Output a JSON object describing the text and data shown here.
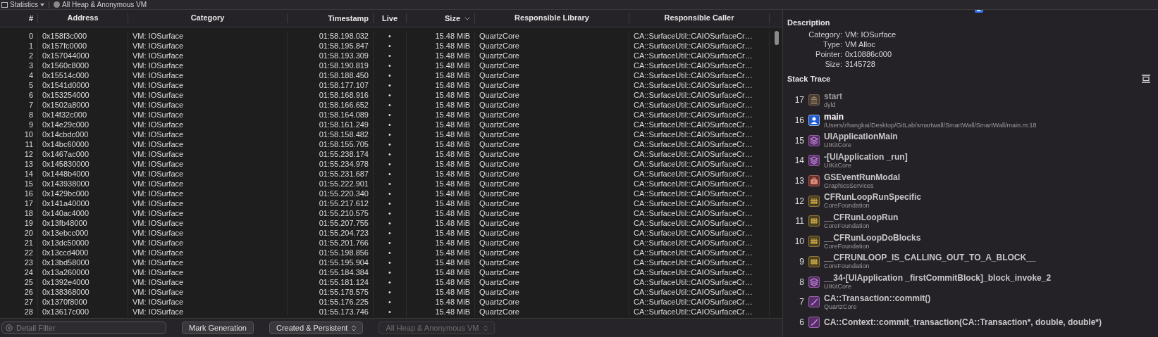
{
  "toolbar": {
    "view_menu": "Statistics",
    "scope": "All Heap & Anonymous VM"
  },
  "table": {
    "columns": [
      {
        "label": "#"
      },
      {
        "label": "Address"
      },
      {
        "label": "Category"
      },
      {
        "label": "Timestamp"
      },
      {
        "label": "Live"
      },
      {
        "label": "Size",
        "sorted": true
      },
      {
        "label": "Responsible Library"
      },
      {
        "label": "Responsible Caller"
      }
    ],
    "rows": [
      [
        "0",
        "0x158f3c000",
        "VM: IOSurface",
        "01:58.198.032",
        "•",
        "15.48 MiB",
        "QuartzCore",
        "CA::SurfaceUtil::CAIOSurfaceCr…"
      ],
      [
        "1",
        "0x157fc0000",
        "VM: IOSurface",
        "01:58.195.847",
        "•",
        "15.48 MiB",
        "QuartzCore",
        "CA::SurfaceUtil::CAIOSurfaceCr…"
      ],
      [
        "2",
        "0x157044000",
        "VM: IOSurface",
        "01:58.193.309",
        "•",
        "15.48 MiB",
        "QuartzCore",
        "CA::SurfaceUtil::CAIOSurfaceCr…"
      ],
      [
        "3",
        "0x1560c8000",
        "VM: IOSurface",
        "01:58.190.819",
        "•",
        "15.48 MiB",
        "QuartzCore",
        "CA::SurfaceUtil::CAIOSurfaceCr…"
      ],
      [
        "4",
        "0x15514c000",
        "VM: IOSurface",
        "01:58.188.450",
        "•",
        "15.48 MiB",
        "QuartzCore",
        "CA::SurfaceUtil::CAIOSurfaceCr…"
      ],
      [
        "5",
        "0x1541d0000",
        "VM: IOSurface",
        "01:58.177.107",
        "•",
        "15.48 MiB",
        "QuartzCore",
        "CA::SurfaceUtil::CAIOSurfaceCr…"
      ],
      [
        "6",
        "0x153254000",
        "VM: IOSurface",
        "01:58.168.916",
        "•",
        "15.48 MiB",
        "QuartzCore",
        "CA::SurfaceUtil::CAIOSurfaceCr…"
      ],
      [
        "7",
        "0x1502a8000",
        "VM: IOSurface",
        "01:58.166.652",
        "•",
        "15.48 MiB",
        "QuartzCore",
        "CA::SurfaceUtil::CAIOSurfaceCr…"
      ],
      [
        "8",
        "0x14f32c000",
        "VM: IOSurface",
        "01:58.164.089",
        "•",
        "15.48 MiB",
        "QuartzCore",
        "CA::SurfaceUtil::CAIOSurfaceCr…"
      ],
      [
        "9",
        "0x14e29c000",
        "VM: IOSurface",
        "01:58.161.249",
        "•",
        "15.48 MiB",
        "QuartzCore",
        "CA::SurfaceUtil::CAIOSurfaceCr…"
      ],
      [
        "10",
        "0x14cbdc000",
        "VM: IOSurface",
        "01:58.158.482",
        "•",
        "15.48 MiB",
        "QuartzCore",
        "CA::SurfaceUtil::CAIOSurfaceCr…"
      ],
      [
        "11",
        "0x14bc60000",
        "VM: IOSurface",
        "01:58.155.705",
        "•",
        "15.48 MiB",
        "QuartzCore",
        "CA::SurfaceUtil::CAIOSurfaceCr…"
      ],
      [
        "12",
        "0x1467ac000",
        "VM: IOSurface",
        "01:55.238.174",
        "•",
        "15.48 MiB",
        "QuartzCore",
        "CA::SurfaceUtil::CAIOSurfaceCr…"
      ],
      [
        "13",
        "0x145830000",
        "VM: IOSurface",
        "01:55.234.978",
        "•",
        "15.48 MiB",
        "QuartzCore",
        "CA::SurfaceUtil::CAIOSurfaceCr…"
      ],
      [
        "14",
        "0x1448b4000",
        "VM: IOSurface",
        "01:55.231.687",
        "•",
        "15.48 MiB",
        "QuartzCore",
        "CA::SurfaceUtil::CAIOSurfaceCr…"
      ],
      [
        "15",
        "0x143938000",
        "VM: IOSurface",
        "01:55.222.901",
        "•",
        "15.48 MiB",
        "QuartzCore",
        "CA::SurfaceUtil::CAIOSurfaceCr…"
      ],
      [
        "16",
        "0x1429bc000",
        "VM: IOSurface",
        "01:55.220.340",
        "•",
        "15.48 MiB",
        "QuartzCore",
        "CA::SurfaceUtil::CAIOSurfaceCr…"
      ],
      [
        "17",
        "0x141a40000",
        "VM: IOSurface",
        "01:55.217.612",
        "•",
        "15.48 MiB",
        "QuartzCore",
        "CA::SurfaceUtil::CAIOSurfaceCr…"
      ],
      [
        "18",
        "0x140ac4000",
        "VM: IOSurface",
        "01:55.210.575",
        "•",
        "15.48 MiB",
        "QuartzCore",
        "CA::SurfaceUtil::CAIOSurfaceCr…"
      ],
      [
        "19",
        "0x13fb48000",
        "VM: IOSurface",
        "01:55.207.755",
        "•",
        "15.48 MiB",
        "QuartzCore",
        "CA::SurfaceUtil::CAIOSurfaceCr…"
      ],
      [
        "20",
        "0x13ebcc000",
        "VM: IOSurface",
        "01:55.204.723",
        "•",
        "15.48 MiB",
        "QuartzCore",
        "CA::SurfaceUtil::CAIOSurfaceCr…"
      ],
      [
        "21",
        "0x13dc50000",
        "VM: IOSurface",
        "01:55.201.766",
        "•",
        "15.48 MiB",
        "QuartzCore",
        "CA::SurfaceUtil::CAIOSurfaceCr…"
      ],
      [
        "22",
        "0x13ccd4000",
        "VM: IOSurface",
        "01:55.198.856",
        "•",
        "15.48 MiB",
        "QuartzCore",
        "CA::SurfaceUtil::CAIOSurfaceCr…"
      ],
      [
        "23",
        "0x13bd58000",
        "VM: IOSurface",
        "01:55.195.904",
        "•",
        "15.48 MiB",
        "QuartzCore",
        "CA::SurfaceUtil::CAIOSurfaceCr…"
      ],
      [
        "24",
        "0x13a260000",
        "VM: IOSurface",
        "01:55.184.384",
        "•",
        "15.48 MiB",
        "QuartzCore",
        "CA::SurfaceUtil::CAIOSurfaceCr…"
      ],
      [
        "25",
        "0x1392e4000",
        "VM: IOSurface",
        "01:55.181.124",
        "•",
        "15.48 MiB",
        "QuartzCore",
        "CA::SurfaceUtil::CAIOSurfaceCr…"
      ],
      [
        "26",
        "0x138368000",
        "VM: IOSurface",
        "01:55.178.575",
        "•",
        "15.48 MiB",
        "QuartzCore",
        "CA::SurfaceUtil::CAIOSurfaceCr…"
      ],
      [
        "27",
        "0x1370f8000",
        "VM: IOSurface",
        "01:55.176.225",
        "•",
        "15.48 MiB",
        "QuartzCore",
        "CA::SurfaceUtil::CAIOSurfaceCr…"
      ],
      [
        "28",
        "0x13617c000",
        "VM: IOSurface",
        "01:55.173.746",
        "•",
        "15.48 MiB",
        "QuartzCore",
        "CA::SurfaceUtil::CAIOSurfaceCr…"
      ]
    ]
  },
  "bottom_bar": {
    "filter": {
      "placeholder": "Detail Filter"
    },
    "mark_button": "Mark Generation",
    "lifetime_popup": "Created & Persistent",
    "scope_popup": {
      "label": "All Heap & Anonymous VM",
      "disabled": true
    }
  },
  "inspector": {
    "description": {
      "title": "Description",
      "fields": [
        {
          "label": "Category:",
          "value": "VM: IOSurface"
        },
        {
          "label": "Type:",
          "value": "VM Alloc"
        },
        {
          "label": "Pointer:",
          "value": "0x10886c000"
        },
        {
          "label": "Size:",
          "value": "3145728"
        }
      ]
    },
    "stack_trace": {
      "title": "Stack Trace",
      "frames": [
        {
          "index": "17",
          "symbol": "start",
          "library": "dyld",
          "kind": "system"
        },
        {
          "index": "16",
          "symbol": "main",
          "library": "/Users/zhangkai/Desktop/GitLab/smartwall/SmartWall/SmartWall/main.m:18",
          "kind": "user"
        },
        {
          "index": "15",
          "symbol": "UIApplicationMain",
          "library": "UIKitCore",
          "kind": "uikit"
        },
        {
          "index": "14",
          "symbol": "-[UIApplication _run]",
          "library": "UIKitCore",
          "kind": "uikit"
        },
        {
          "index": "13",
          "symbol": "GSEventRunModal",
          "library": "GraphicsServices",
          "kind": "services"
        },
        {
          "index": "12",
          "symbol": "CFRunLoopRunSpecific",
          "library": "CoreFoundation",
          "kind": "foundation"
        },
        {
          "index": "11",
          "symbol": "__CFRunLoopRun",
          "library": "CoreFoundation",
          "kind": "foundation"
        },
        {
          "index": "10",
          "symbol": "__CFRunLoopDoBlocks",
          "library": "CoreFoundation",
          "kind": "foundation"
        },
        {
          "index": "9",
          "symbol": "__CFRUNLOOP_IS_CALLING_OUT_TO_A_BLOCK__",
          "library": "CoreFoundation",
          "kind": "foundation"
        },
        {
          "index": "8",
          "symbol": "__34-[UIApplication _firstCommitBlock]_block_invoke_2",
          "library": "UIKitCore",
          "kind": "uikit"
        },
        {
          "index": "7",
          "symbol": "CA::Transaction::commit()",
          "library": "QuartzCore",
          "kind": "graphics"
        },
        {
          "index": "6",
          "symbol": "CA::Context::commit_transaction(CA::Transaction*, double, double*)",
          "kind": "graphics"
        }
      ]
    }
  }
}
